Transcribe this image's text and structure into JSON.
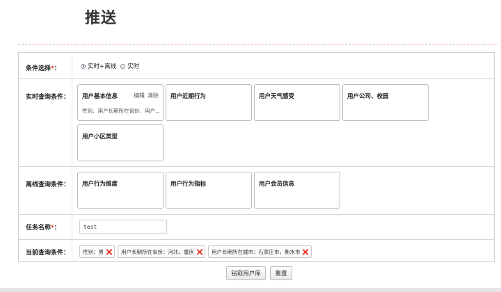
{
  "page": {
    "title": "推送"
  },
  "form": {
    "condition_select": {
      "label": "条件选择",
      "required_mark": "*",
      "label_suffix": "：",
      "options": [
        "实时+离线",
        "实时"
      ],
      "selected": "实时+离线"
    },
    "realtime": {
      "label": "实时查询条件：",
      "cards": [
        {
          "title": "用户基本信息",
          "desc": "性别、用户长期所在省份、用户...",
          "actions": [
            "编辑",
            "清除"
          ]
        },
        {
          "title": "用户近期行为"
        },
        {
          "title": "用户天气感受"
        },
        {
          "title": "用户公司、校园"
        },
        {
          "title": "用户小区类型"
        }
      ]
    },
    "offline": {
      "label": "离线查询条件：",
      "cards": [
        {
          "title": "用户行为维度"
        },
        {
          "title": "用户行为指标"
        },
        {
          "title": "用户会员信息"
        }
      ]
    },
    "task_name": {
      "label": "任务名称",
      "required_mark": "*",
      "label_suffix": "：",
      "value": "test"
    },
    "current": {
      "label": "当前查询条件：",
      "tags": [
        "性别：男",
        "用户长期所在省份：河北，重庆",
        "用户长期所在城市：石家庄市，衡水市"
      ]
    }
  },
  "buttons": {
    "submit": "钻取用户库",
    "reset": "重置"
  },
  "colors": {
    "required": "#e3372b",
    "tag_remove": "#e23b2c",
    "radio_selected": "#2a66c8"
  }
}
